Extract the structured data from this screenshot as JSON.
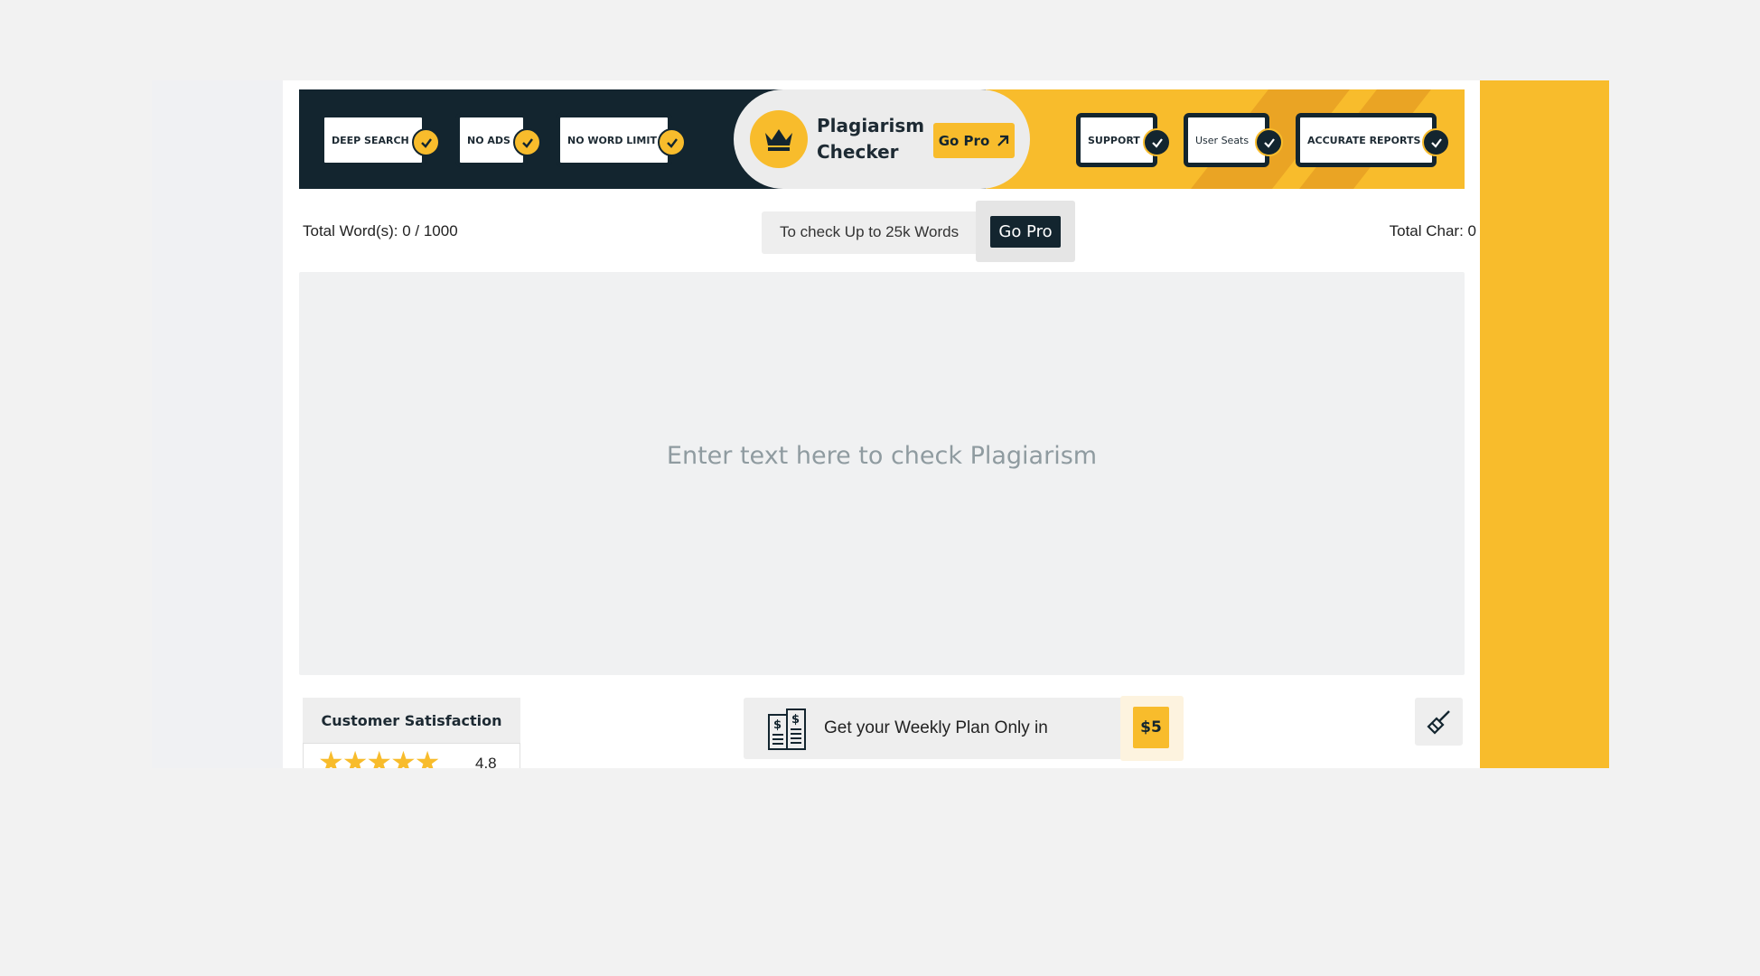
{
  "banner": {
    "features_left": [
      "DEEP SEARCH",
      "NO ADS",
      "NO WORD LIMIT"
    ],
    "product_title_line1": "Plagiarism",
    "product_title_line2": "Checker",
    "go_pro_label": "Go Pro",
    "features_right": [
      "SUPPORT",
      "User Seats",
      "ACCURATE REPORTS"
    ]
  },
  "stats": {
    "words": "Total Word(s): 0 / 1000",
    "upsell_text": "To check Up to 25k Words",
    "upsell_button": "Go Pro",
    "chars": "Total Char: 0"
  },
  "editor": {
    "placeholder": "Enter text here to check Plagiarism"
  },
  "footer": {
    "satisfaction_title": "Customer Satisfaction",
    "rating": "4.8",
    "weekly_text": "Get your Weekly Plan Only in",
    "price": "$5"
  },
  "colors": {
    "brand_dark": "#13252f",
    "brand_yellow": "#f8bc2c"
  },
  "icons": [
    "crown-icon",
    "arrow-up-right-icon",
    "check-icon",
    "star-icon",
    "receipt-dollar-icon",
    "brush-icon"
  ]
}
